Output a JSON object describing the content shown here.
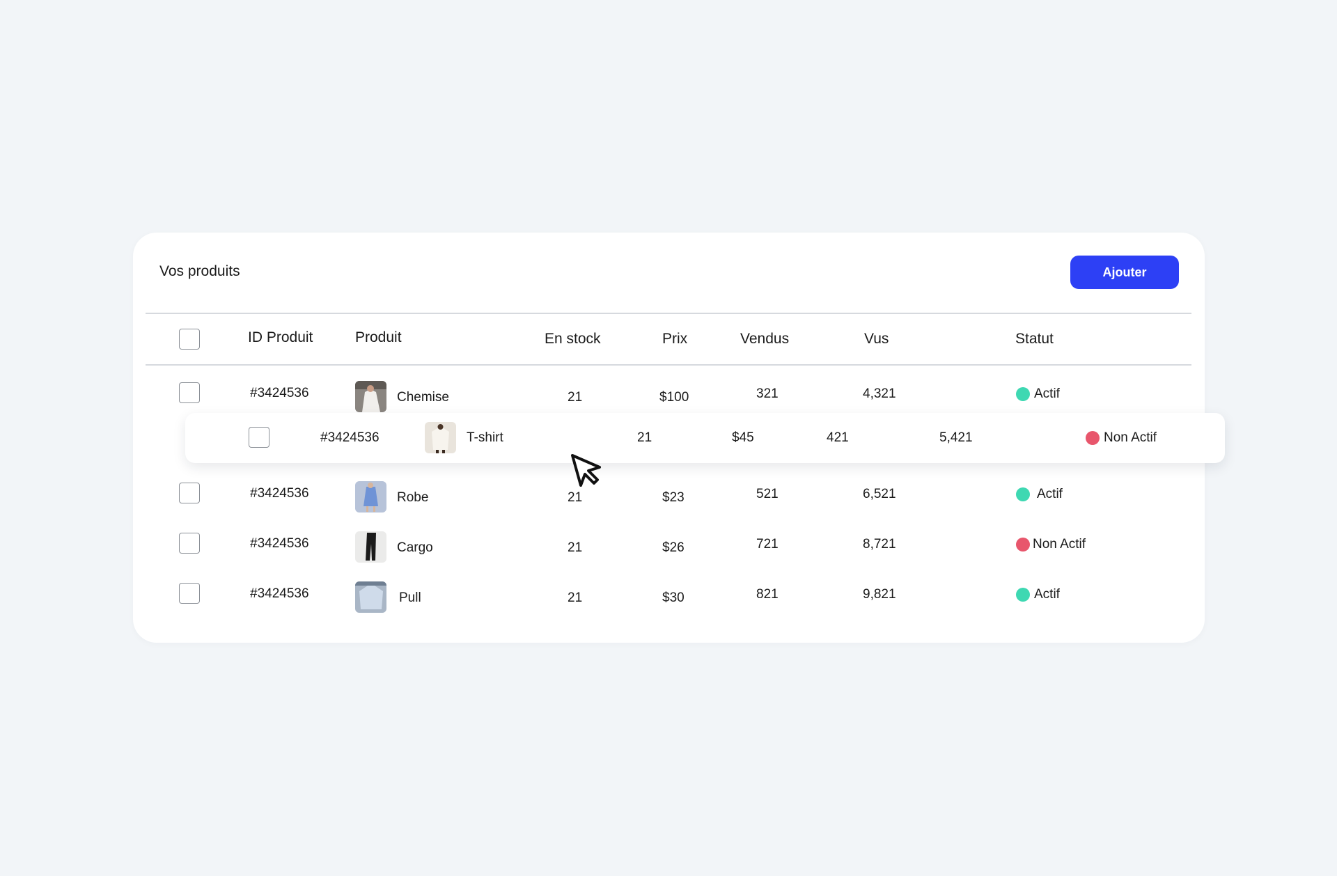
{
  "card": {
    "title": "Vos produits",
    "add_label": "Ajouter"
  },
  "colors": {
    "accent": "#2d40f5",
    "active": "#3ed8b2",
    "inactive": "#e8566c"
  },
  "headers": {
    "id": "ID Produit",
    "product": "Produit",
    "stock": "En stock",
    "price": "Prix",
    "sold": "Vendus",
    "views": "Vus",
    "status": "Statut"
  },
  "rows": [
    {
      "id": "#3424536",
      "name": "Chemise",
      "stock": "21",
      "price": "$100",
      "sold": "321",
      "views": "4,321",
      "status": "Actif",
      "status_type": "active",
      "icon": "shirt-photo"
    },
    {
      "id": "#3424536",
      "name": "Robe",
      "stock": "21",
      "price": "$23",
      "sold": "521",
      "views": "6,521",
      "status": "Actif",
      "status_type": "active",
      "icon": "dress-photo"
    },
    {
      "id": "#3424536",
      "name": "Cargo",
      "stock": "21",
      "price": "$26",
      "sold": "721",
      "views": "8,721",
      "status": "Non Actif",
      "status_type": "inactive",
      "icon": "cargo-pants-photo"
    },
    {
      "id": "#3424536",
      "name": "Pull",
      "stock": "21",
      "price": "$30",
      "sold": "821",
      "views": "9,821",
      "status": "Actif",
      "status_type": "active",
      "icon": "sweater-photo"
    }
  ],
  "dragged_row": {
    "id": "#3424536",
    "name": "T-shirt",
    "stock": "21",
    "price": "$45",
    "sold": "421",
    "views": "5,421",
    "status": "Non Actif",
    "status_type": "inactive",
    "icon": "tshirt-photo"
  },
  "cursor_icon": "arrow-cursor-icon"
}
